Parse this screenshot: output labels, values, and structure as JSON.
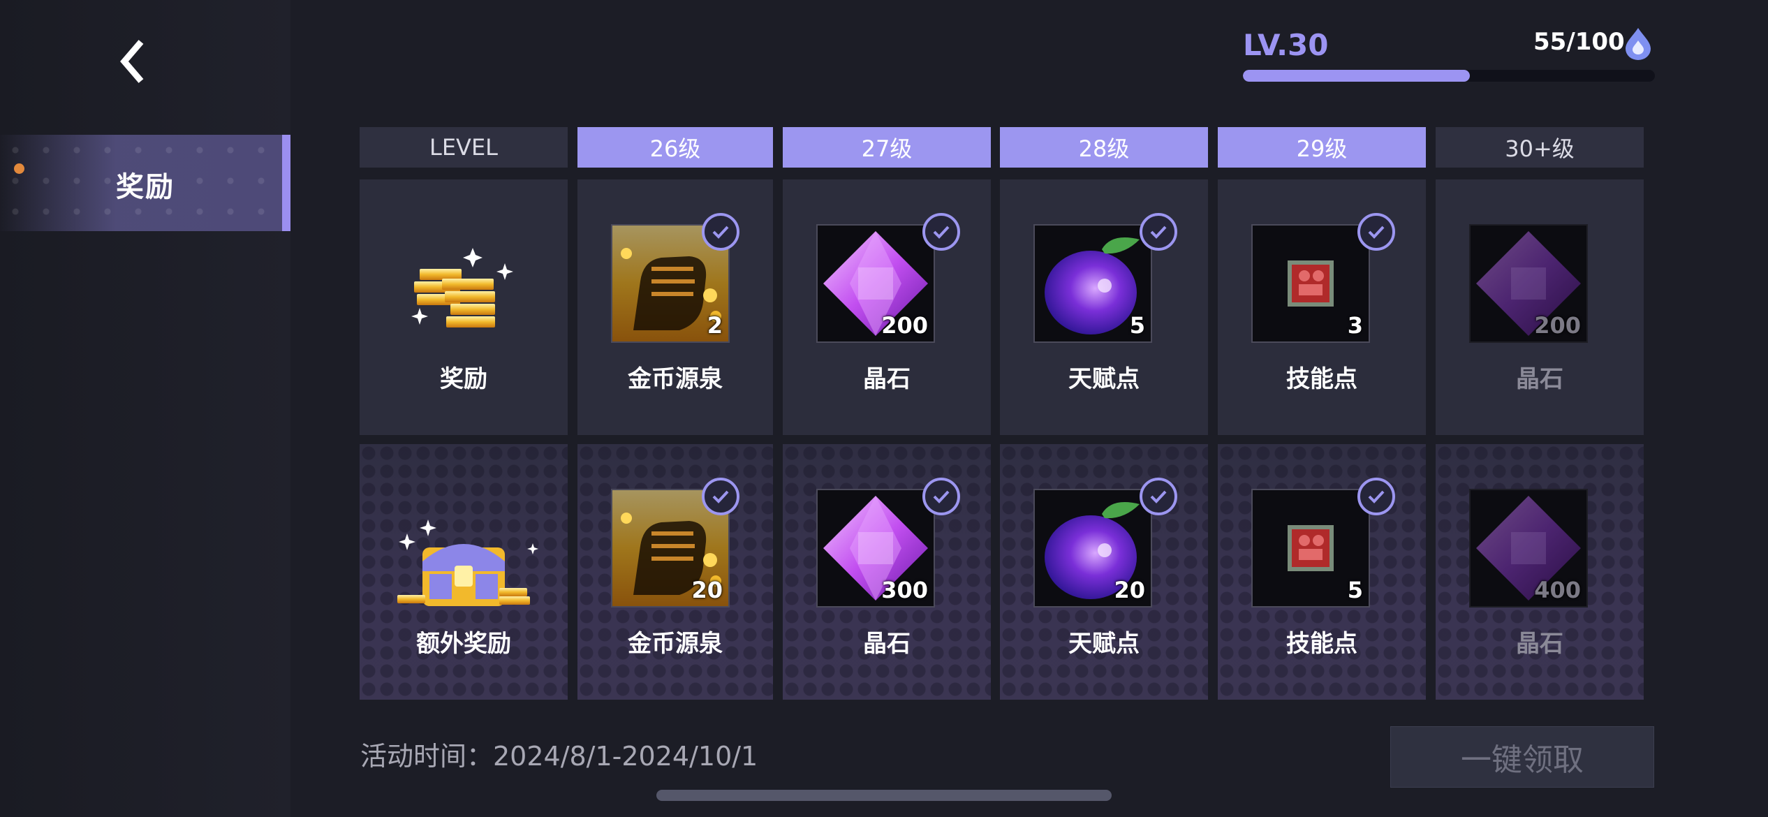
{
  "sidebar": {
    "tab_label": "奖励"
  },
  "level": {
    "label": "LV.30",
    "exp_text": "55/100",
    "exp_progress": 0.55
  },
  "header": {
    "level_label": "LEVEL",
    "columns": [
      "26级",
      "27级",
      "28级",
      "29级",
      "30+级"
    ]
  },
  "rows": [
    {
      "label": "奖励",
      "icon": "gold-bars-icon",
      "items": [
        {
          "name": "金币源泉",
          "count": "2",
          "icon": "gold-fist-icon",
          "claimed": true
        },
        {
          "name": "晶石",
          "count": "200",
          "icon": "purple-crystal-icon",
          "claimed": true
        },
        {
          "name": "天赋点",
          "count": "5",
          "icon": "purple-fruit-icon",
          "claimed": true
        },
        {
          "name": "技能点",
          "count": "3",
          "icon": "skill-chip-icon",
          "claimed": true
        },
        {
          "name": "晶石",
          "count": "200",
          "icon": "purple-crystal-icon",
          "claimed": false
        }
      ]
    },
    {
      "label": "额外奖励",
      "icon": "treasure-chest-icon",
      "items": [
        {
          "name": "金币源泉",
          "count": "20",
          "icon": "gold-fist-icon",
          "claimed": true
        },
        {
          "name": "晶石",
          "count": "300",
          "icon": "purple-crystal-icon",
          "claimed": true
        },
        {
          "name": "天赋点",
          "count": "20",
          "icon": "purple-fruit-icon",
          "claimed": true
        },
        {
          "name": "技能点",
          "count": "5",
          "icon": "skill-chip-icon",
          "claimed": true
        },
        {
          "name": "晶石",
          "count": "400",
          "icon": "purple-crystal-icon",
          "claimed": false
        }
      ]
    }
  ],
  "footer": {
    "time_text": "活动时间：2024/8/1-2024/10/1",
    "claim_all_label": "一键领取"
  },
  "colors": {
    "accent": "#9c96f0",
    "background": "#1c1d26",
    "cell": "#2c2d3c"
  }
}
